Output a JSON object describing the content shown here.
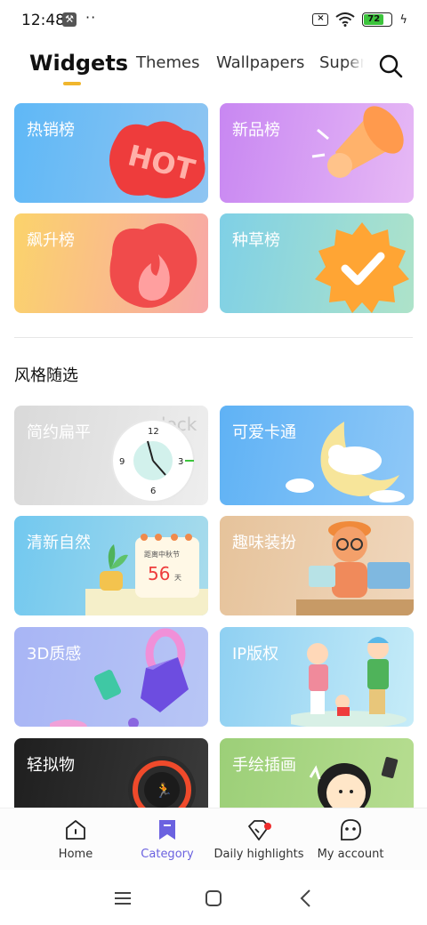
{
  "status": {
    "time": "12:48",
    "dots": "··",
    "battery": "72"
  },
  "tabs": [
    {
      "label": "Widgets"
    },
    {
      "label": "Themes"
    },
    {
      "label": "Wallpapers"
    },
    {
      "label": "Super"
    }
  ],
  "top_cards": [
    {
      "label": "热销榜",
      "art_text": "HOT"
    },
    {
      "label": "新品榜"
    },
    {
      "label": "飙升榜"
    },
    {
      "label": "种草榜"
    }
  ],
  "section_title": "风格随选",
  "style_cards": [
    {
      "label": "简约扁平",
      "clock_numbers": [
        "12",
        "3",
        "6",
        "9"
      ],
      "watermark": "clock"
    },
    {
      "label": "可爱卡通"
    },
    {
      "label": "清新自然",
      "calendar_caption": "距离中秋节",
      "calendar_number": "56",
      "calendar_unit": "天"
    },
    {
      "label": "趣味装扮"
    },
    {
      "label": "3D质感"
    },
    {
      "label": "IP版权"
    },
    {
      "label": "轻拟物"
    },
    {
      "label": "手绘插画"
    }
  ],
  "bottom_nav": [
    {
      "label": "Home",
      "icon": "home-icon"
    },
    {
      "label": "Category",
      "icon": "bookmark-icon"
    },
    {
      "label": "Daily highlights",
      "icon": "diamond-icon"
    },
    {
      "label": "My account",
      "icon": "smiley-icon"
    }
  ],
  "colors": {
    "accent": "#6b62e0",
    "tab_underline": "#f0b62d",
    "badge": "#ee2c2c"
  }
}
